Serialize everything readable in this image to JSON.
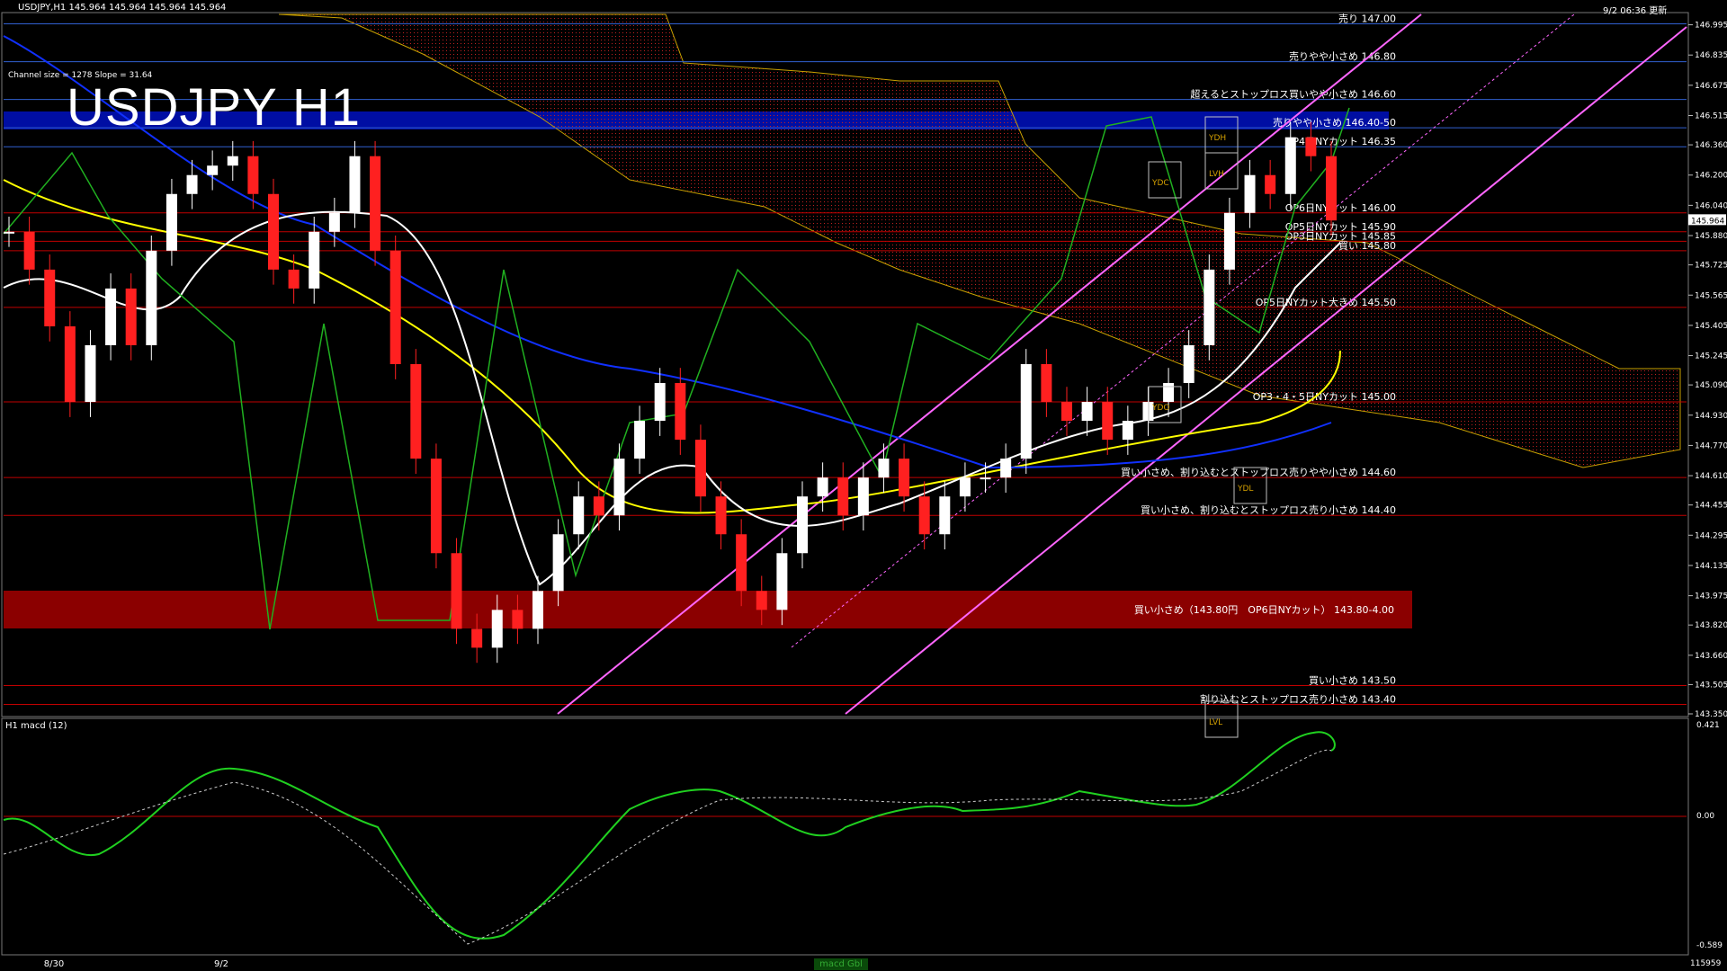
{
  "header": {
    "symbol_line": "USDJPY,H1  145.964 145.964 145.964 145.964",
    "timestamp": "9/2 06:36 更新",
    "channel_info": "Channel size = 1278 Slope = 31.64",
    "watermark": "USDJPY H1"
  },
  "price_levels": [
    {
      "label": "売り 147.00",
      "price": 147.0
    },
    {
      "label": "売りやや小さめ 146.80",
      "price": 146.8
    },
    {
      "label": "超えるとストップロス買いやや小さめ 146.60",
      "price": 146.6
    },
    {
      "label": "売りやや小さめ 146.40-50",
      "price": 146.45
    },
    {
      "label": "OP4日NYカット 146.35",
      "price": 146.35
    },
    {
      "label": "OP6日NYカット 146.00",
      "price": 146.0
    },
    {
      "label": "OP5日NYカット 145.90",
      "price": 145.9
    },
    {
      "label": "OP3日NYカット 145.85",
      "price": 145.85
    },
    {
      "label": "買い 145.80",
      "price": 145.8
    },
    {
      "label": "OP5日NYカット大きめ 145.50",
      "price": 145.5
    },
    {
      "label": "OP3・4・5日NYカット 145.00",
      "price": 145.0
    },
    {
      "label": "買い小さめ、割り込むとストップロス売りやや小さめ 144.60",
      "price": 144.6
    },
    {
      "label": "買い小さめ、割り込むとストップロス売り小さめ 144.40",
      "price": 144.4
    },
    {
      "label": "買い小さめ 143.50",
      "price": 143.5
    },
    {
      "label": "割り込むとストップロス売り小さめ 143.40",
      "price": 143.4
    }
  ],
  "band": {
    "label": "買い小さめ（143.80円　OP6日NYカット） 143.80-4.00"
  },
  "chart_labels": {
    "ydh": "YDH",
    "ydc": "YDC",
    "ydo": "YDO",
    "ydl": "YDL",
    "lvh": "LVH",
    "lvl": "LVL"
  },
  "macd": {
    "title": "H1  macd (12)",
    "axis_top": "0.421",
    "axis_zero": "0.00",
    "axis_bottom": "-0.589",
    "footer": "115959"
  },
  "bottom_tabs": [
    "8/30",
    "9/2",
    "macd Gbl"
  ],
  "current_price": "145.964",
  "colors": {
    "support_line": "#c00000",
    "channel": "#ff66ff",
    "band": "#8b0000",
    "blue_zone": "#0010c0"
  },
  "chart_data": {
    "type": "line",
    "title": "USDJPY H1",
    "ylim": [
      143.35,
      147.05
    ],
    "y_ticks": [
      146.995,
      146.835,
      146.675,
      146.515,
      146.36,
      146.2,
      146.04,
      145.88,
      145.725,
      145.565,
      145.405,
      145.245,
      145.09,
      144.93,
      144.77,
      144.61,
      144.455,
      144.295,
      144.135,
      143.975,
      143.82,
      143.66,
      143.505,
      143.35
    ],
    "series": [
      {
        "values": [
          145.9,
          145.7,
          145.4,
          145.0,
          145.3,
          145.6,
          145.3,
          145.8,
          146.1,
          146.2,
          146.25,
          146.3,
          146.1,
          145.7,
          145.6,
          145.9,
          146.0,
          146.3,
          145.8,
          145.2,
          144.7,
          144.2,
          143.8,
          143.7,
          143.9,
          143.8,
          144.0,
          144.3,
          144.5,
          144.4,
          144.7,
          144.9,
          145.1,
          144.8,
          144.5,
          144.3,
          144.0,
          143.9,
          144.2,
          144.5,
          144.6,
          144.4,
          144.6,
          144.7,
          144.5,
          144.3,
          144.5,
          144.6,
          144.6,
          144.7,
          145.2,
          145.0,
          144.9,
          145.0,
          144.8,
          144.9,
          145.0,
          145.1,
          145.3,
          145.7,
          146.0,
          146.2,
          146.1,
          146.4,
          146.3,
          145.96
        ]
      }
    ]
  }
}
